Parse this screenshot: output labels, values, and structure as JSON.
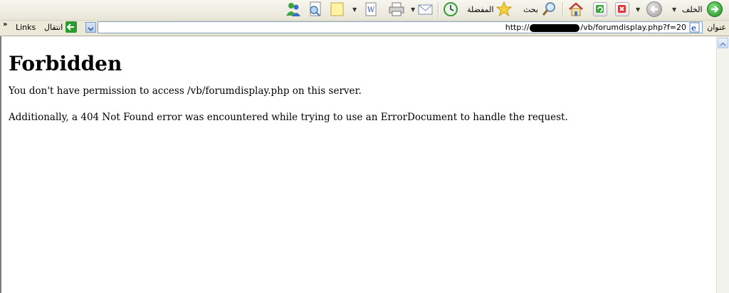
{
  "toolbar": {
    "back_label": "الخلف",
    "favorites_label": "المفضلة",
    "search_label": "بحث"
  },
  "address": {
    "label": "عنوان",
    "url_prefix": "http://",
    "url_suffix": "/vb/forumdisplay.php?f=20",
    "go_label": "انتقال",
    "links_label": "Links"
  },
  "page": {
    "heading": "Forbidden",
    "para1": "You don't have permission to access /vb/forumdisplay.php on this server.",
    "para2": "Additionally, a 404 Not Found error was encountered while trying to use an ErrorDocument to handle the request."
  }
}
